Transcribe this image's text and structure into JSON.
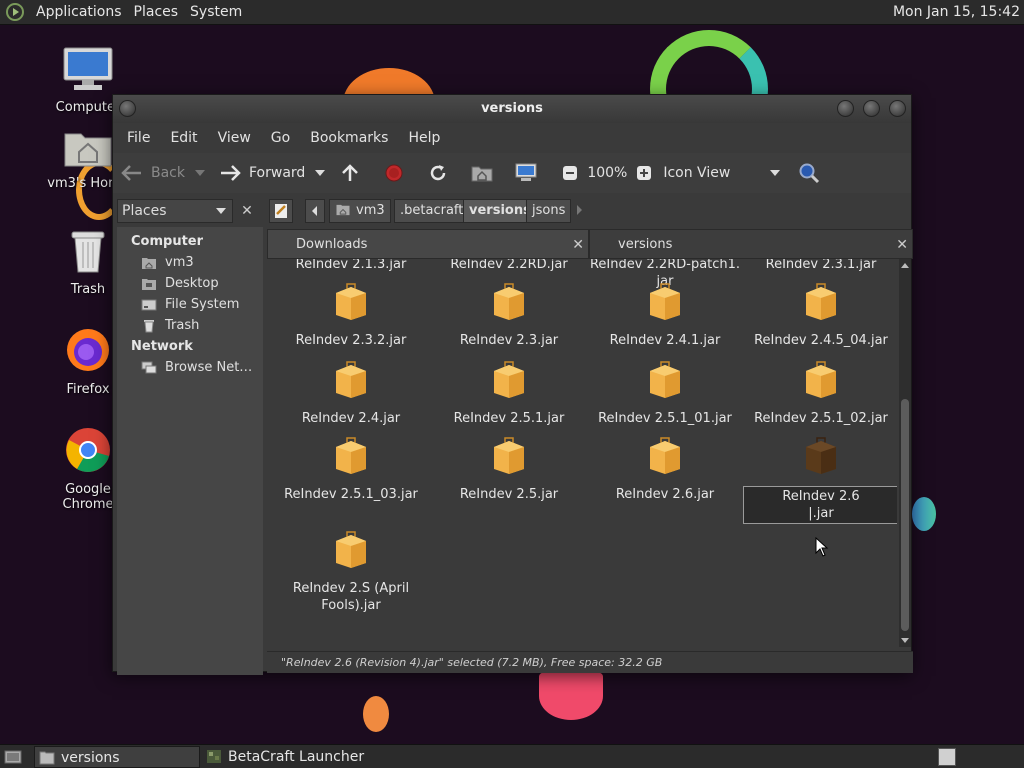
{
  "top_panel": {
    "menus": [
      "Applications",
      "Places",
      "System"
    ],
    "clock": "Mon Jan 15, 15:42"
  },
  "desktop_icons": [
    {
      "label": "Computer",
      "icon": "computer-icon"
    },
    {
      "label": "vm3's Home",
      "icon": "home-folder-icon"
    },
    {
      "label": "Trash",
      "icon": "trash-icon"
    },
    {
      "label": "Firefox",
      "icon": "firefox-icon"
    },
    {
      "label": "Google Chrome",
      "icon": "chrome-icon"
    }
  ],
  "window": {
    "title": "versions",
    "menu": [
      "File",
      "Edit",
      "View",
      "Go",
      "Bookmarks",
      "Help"
    ],
    "toolbar": {
      "back": "Back",
      "forward": "Forward",
      "zoom": "100%",
      "view_mode": "Icon View"
    },
    "sidebar": {
      "combo": "Places",
      "close": "✕",
      "sections": [
        {
          "heading": "Computer",
          "items": [
            {
              "label": "vm3",
              "icon": "home-icon"
            },
            {
              "label": "Desktop",
              "icon": "desktop-icon"
            },
            {
              "label": "File System",
              "icon": "drive-icon"
            },
            {
              "label": "Trash",
              "icon": "trash-icon"
            }
          ]
        },
        {
          "heading": "Network",
          "items": [
            {
              "label": "Browse Net…",
              "icon": "network-icon"
            }
          ]
        }
      ]
    },
    "breadcrumbs": [
      "vm3",
      ".betacraft",
      "versions",
      "jsons"
    ],
    "active_crumb": "versions",
    "tabs": [
      {
        "label": "Downloads",
        "close": "✕"
      },
      {
        "label": "versions",
        "close": "✕"
      }
    ],
    "files": [
      "ReIndev 2.1.3.jar",
      "ReIndev 2.2RD.jar",
      "ReIndev 2.2RD-patch1.\njar",
      "ReIndev 2.3.1.jar",
      "ReIndev 2.3.2.jar",
      "ReIndev 2.3.jar",
      "ReIndev 2.4.1.jar",
      "ReIndev 2.4.5_04.jar",
      "ReIndev 2.4.jar",
      "ReIndev 2.5.1.jar",
      "ReIndev 2.5.1_01.jar",
      "ReIndev 2.5.1_02.jar",
      "ReIndev 2.5.1_03.jar",
      "ReIndev 2.5.jar",
      "ReIndev 2.6.jar",
      "ReIndev 2.6 |.jar",
      "ReIndev 2.S (April\nFools).jar"
    ],
    "status": "\"ReIndev 2.6 (Revision 4).jar\" selected (7.2 MB), Free space: 32.2 GB"
  },
  "taskbar": [
    {
      "label": "versions",
      "active": true
    },
    {
      "label": "BetaCraft Launcher …",
      "active": false
    }
  ]
}
